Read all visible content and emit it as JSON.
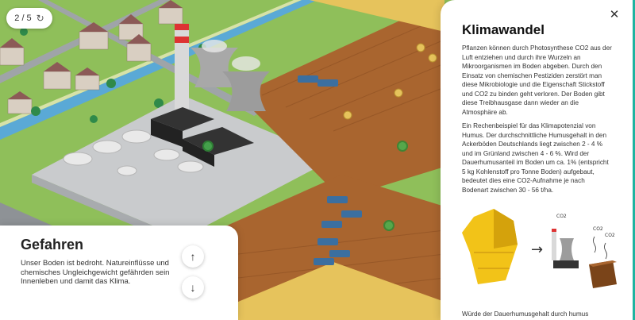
{
  "progress": {
    "label": "2 / 5",
    "reload_icon": "↻"
  },
  "left_panel": {
    "title": "Gefahren",
    "text": "Unser Boden ist bedroht. Natureinflüsse und chemisches Ungleichgewicht gefährden sein Innenleben und damit das Klima.",
    "up_icon": "↑",
    "down_icon": "↓"
  },
  "right_panel": {
    "title": "Klimawandel",
    "close_icon": "✕",
    "paragraph1": "Pflanzen können durch Photosynthese CO2 aus der Luft entziehen und durch ihre Wurzeln an Mikroorganismen im Boden abgeben. Durch den Einsatz von chemischen Pestiziden zerstört man diese Mikrobiologie und die Eigenschaft Stickstoff und CO2 zu binden geht verloren. Der Boden gibt diese Treibhausgase dann wieder an die Atmosphäre ab.",
    "paragraph2": "Ein Rechenbeispiel für das Klimapotenzial von Humus. Der durchschnittliche Humusgehalt in den Ackerböden Deutschlands liegt zwischen 2 - 4 % und im Grünland zwischen 4 - 6 %. Wird der Dauerhumusanteil im Boden um ca. 1% (entspricht 5 kg Kohlenstoff pro Tonne Boden) aufgebaut, bedeutet dies eine CO2-Aufnahme je nach Bodenart zwischen 30 - 56 t/ha.",
    "paragraph3": "Würde der Dauerhumusgehalt durch humus",
    "illustration": {
      "arrow": "→",
      "co2_labels": [
        "CO2",
        "CO2",
        "CO2"
      ]
    }
  },
  "colors": {
    "accent": "#1fb3a0",
    "field": "#a9652f",
    "grass": "#8fbf5a"
  }
}
